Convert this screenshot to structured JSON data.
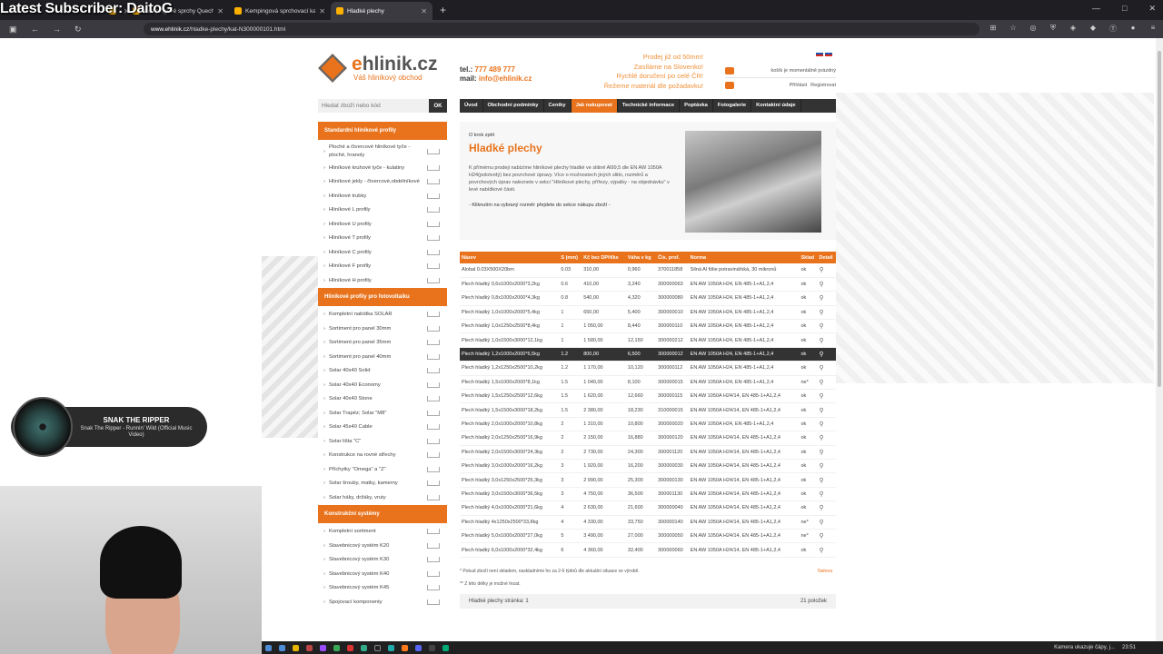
{
  "overlay": {
    "stream_title": "Latest Subscriber: DaitoG"
  },
  "browser": {
    "tabs": [
      {
        "label": "kout",
        "active": false
      },
      {
        "label": "Kempingové sprchy Quechua -",
        "active": false
      },
      {
        "label": "Kempingová sprchovací kabína",
        "active": false
      },
      {
        "label": "Hladké plechy",
        "active": true
      }
    ],
    "url_host": "www.ehlinik.cz",
    "url_path": "/hladke-plechy/kat-N300000101.html"
  },
  "header": {
    "logo_name_a": "e",
    "logo_name_b": "hlinik.cz",
    "logo_sub": "Váš hliníkový obchod",
    "tel_label": "tel.:",
    "tel_value": "777 489 777",
    "mail_label": "mail:",
    "mail_value": "info@ehlinik.cz",
    "promo": [
      "Prodej již od 50mm!",
      "Zasíláme na Slovenko!",
      "Rychlé doručení po celé ČR!",
      "Řežeme materiál dle požadavku!"
    ],
    "cart_text": "košík je momentálně prázdný",
    "login": "Přihlásit",
    "register": "Registrovat"
  },
  "search": {
    "placeholder": "Hledat zboží nebo kód",
    "button": "OK"
  },
  "nav": [
    "Úvod",
    "Obchodní podmínky",
    "Ceníky",
    "Jak nakupovat",
    "Technické informace",
    "Poptávka",
    "Fotogalerie",
    "Kontaktní údaje"
  ],
  "sidebar": {
    "sections": [
      {
        "title": "Standardní hliníkové profily",
        "items": [
          "Ploché a čtvercové hliníkové tyče - ploché, hranoly",
          "Hliníkové kruhové tyče - kulatiny",
          "Hliníkové jekly - čtvercové,obdélníkové",
          "Hliníkové trubky",
          "Hliníkové L profily",
          "Hliníkové U profily",
          "Hliníkové T profily",
          "Hliníkové C profily",
          "Hliníkové F profily",
          "Hliníkové H profily"
        ]
      },
      {
        "title": "Hliníkové profily pro fotovoltaiku",
        "items": [
          "Kompletní nabídka SOLAR",
          "Sortiment pro panel 30mm",
          "Sortiment pro panel 35mm",
          "Sortiment pro panel 40mm",
          "Solar 40x40 Solid",
          "Solar 40x40 Economy",
          "Solar 40x40 Stone",
          "Solar Trapéz; Solar \"M8\"",
          "Solar 45x40 Cable",
          "Solar lišta \"C\"",
          "Konstrukce na rovné střechy",
          "Příchytky \"Omega\" a \"Z\"",
          "Solar šrouby, matky, kamerny",
          "Solar háky, držáky, vruty"
        ]
      },
      {
        "title": "Konstrukční systémy",
        "items": [
          "Kompletní sortiment",
          "Stavebnicový systém K20",
          "Stavebnicový systém K30",
          "Stavebnicový systém K40",
          "Stavebnicový systém K45",
          "Spojovací komponenty"
        ]
      }
    ]
  },
  "content": {
    "back": "O krok zpět",
    "title": "Hladké plechy",
    "intro": "K přímému prodeji nabízíme hliníkové plechy hladké ve slitině Al99,5 dle EN AW 1050A H24(polotvrdý) bez povrchové úpravy. Více o možnostech jiných slitin, rozměrů a povrchových úprav naleznete v sekci \"Hliníkové plechy, přířezy, výpalky - na objednávku\" v levé nabídkové části.",
    "note": "- Kliknutím na vybraný rozměr přejdete do sekce nákupu zboží -"
  },
  "table": {
    "headers": [
      "Název",
      "S (mm)",
      "Kč bez DPH/ks",
      "Váha v kg",
      "Čís. prof.",
      "Norma",
      "Sklad",
      "Detail"
    ],
    "rows": [
      [
        "Alobal 0.03X500X20bm",
        "0.03",
        "310,00",
        "0,960",
        "370011858",
        "Silná Al fólie potravinářská, 30 mikronů",
        "ok"
      ],
      [
        "Plech hladký 0,6x1000x2000*3,2kg",
        "0.6",
        "410,00",
        "3,240",
        "300000063",
        "EN AW 1050A H24, EN 485-1+A1,2,4",
        "ok"
      ],
      [
        "Plech hladký 0,8x1000x2000*4,3kg",
        "0.8",
        "540,00",
        "4,320",
        "300000080",
        "EN AW 1050A H24, EN 485-1+A1,2,4",
        "ok"
      ],
      [
        "Plech hladký 1,0x1000x2000*5,4kg",
        "1",
        "650,00",
        "5,400",
        "300000010",
        "EN AW 1050A H24, EN 485-1+A1,2,4",
        "ok"
      ],
      [
        "Plech hladký 1,0x1250x2500*8,4kg",
        "1",
        "1 050,00",
        "8,440",
        "300000110",
        "EN AW 1050A H24, EN 485-1+A1,2,4",
        "ok"
      ],
      [
        "Plech hladký 1,0x1500x3000*12,1kg",
        "1",
        "1 580,00",
        "12,150",
        "300000212",
        "EN AW 1050A H24, EN 485-1+A1,2,4",
        "ok"
      ],
      [
        "Plech hladký 1,2x1000x2000*6,5kg",
        "1.2",
        "800,00",
        "6,500",
        "300000012",
        "EN AW 1050A H24, EN 485-1+A1,2,4",
        "ok"
      ],
      [
        "Plech hladký 1,2x1250x2500*10,2kg",
        "1.2",
        "1 170,00",
        "10,120",
        "300000112",
        "EN AW 1050A H24, EN 485-1+A1,2,4",
        "ok"
      ],
      [
        "Plech hladký 1,5x1000x2000*8,1kg",
        "1.5",
        "1 040,00",
        "8,100",
        "300000015",
        "EN AW 1050A H24, EN 485-1+A1,2,4",
        "ne*"
      ],
      [
        "Plech hladký 1,5x1250x2500*12,6kg",
        "1.5",
        "1 620,00",
        "12,660",
        "300000115",
        "EN AW 1050A H24/14, EN 485-1+A1,2,4",
        "ok"
      ],
      [
        "Plech hladký 1,5x1500x3000*18,2kg",
        "1.5",
        "2 380,00",
        "18,230",
        "310000015",
        "EN AW 1050A H24/14, EN 485-1+A1,2,4",
        "ok"
      ],
      [
        "Plech hladký 2,0x1000x2000*10,8kg",
        "2",
        "1 310,00",
        "10,800",
        "300000020",
        "EN AW 1050A H24, EN 485-1+A1,2,4",
        "ok"
      ],
      [
        "Plech hladký 2,0x1250x2500*16,9kg",
        "2",
        "2 150,00",
        "16,880",
        "300000120",
        "EN AW 1050A H24/14, EN 485-1+A1,2,4",
        "ok"
      ],
      [
        "Plech hladký 2,0x1500x3000*24,3kg",
        "2",
        "2 730,00",
        "24,300",
        "300001120",
        "EN AW 1050A H24/14, EN 485-1+A1,2,4",
        "ok"
      ],
      [
        "Plech hladký 3,0x1000x2000*16,2kg",
        "3",
        "1 920,00",
        "16,200",
        "300000030",
        "EN AW 1050A H24/14, EN 485-1+A1,2,4",
        "ok"
      ],
      [
        "Plech hladký 3,0x1250x2500*25,3kg",
        "3",
        "2 990,00",
        "25,300",
        "300000130",
        "EN AW 1050A H24/14, EN 485-1+A1,2,4",
        "ok"
      ],
      [
        "Plech hladký 3,0x1500x3000*36,5kg",
        "3",
        "4 750,00",
        "36,500",
        "300001130",
        "EN AW 1050A H24/14, EN 485-1+A1,2,4",
        "ok"
      ],
      [
        "Plech hladký 4,0x1000x2000*21,6kg",
        "4",
        "2 630,00",
        "21,600",
        "300000040",
        "EN AW 1050A H24/14, EN 485-1+A1,2,4",
        "ok"
      ],
      [
        "Plech hladký 4x1250x2500*33,8kg",
        "4",
        "4 330,00",
        "33,750",
        "300000140",
        "EN AW 1050A H24/14, EN 485-1+A1,2,4",
        "ne*"
      ],
      [
        "Plech hladký 5,0x1000x2000*27,0kg",
        "5",
        "3 490,00",
        "27,000",
        "300000050",
        "EN AW 1050A H24/14, EN 485-1+A1,2,4",
        "ne*"
      ],
      [
        "Plech hladký 6,0x1000x2000*32,4kg",
        "6",
        "4 360,00",
        "32,400",
        "300000060",
        "EN AW 1050A H24/14, EN 485-1+A1,2,4",
        "ok"
      ]
    ],
    "selected_row": 6
  },
  "footer": {
    "note1": "* Pokud zboží není skladem, naskladníme ho za 2-6 týdnů dle aktuální situace ve výrobě.",
    "note2": "** Z této délky je možné řezat.",
    "top_link": "Nahoru",
    "pager_label": "Hladké plechy stránka: 1",
    "count": "21 položek"
  },
  "music": {
    "title": "SNAK THE RIPPER",
    "subtitle": "Snak The Ripper - Runnin' Wild (Official Music Video)"
  },
  "taskbar": {
    "news": "Kamera ukazuje čápy, j...",
    "time": "23:51"
  },
  "colors": {
    "accent": "#e8731c",
    "dark": "#333333"
  }
}
